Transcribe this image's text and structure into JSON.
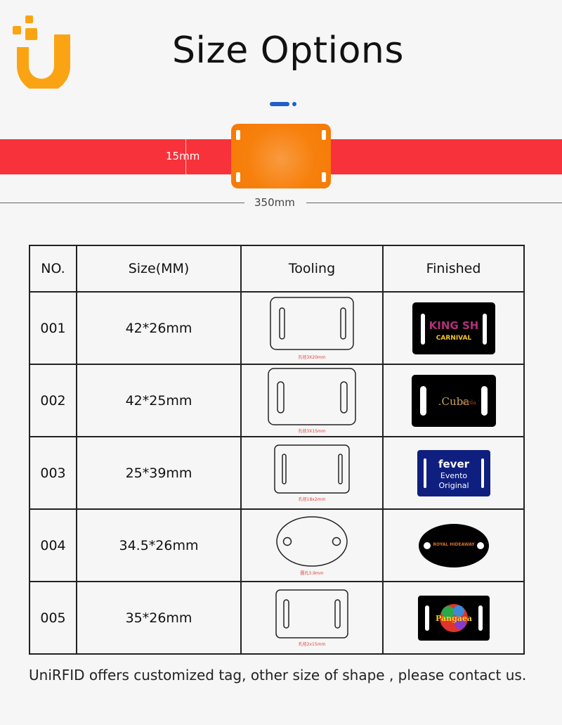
{
  "brand": {
    "logo_icon": "unirfid-u-logo-icon",
    "color_primary": "#fba413"
  },
  "header": {
    "title": "Size Options",
    "accent_color": "#1f5fc6"
  },
  "strap_diagram": {
    "width_label": "15mm",
    "length_label": "350mm",
    "strap_color": "#f7323a",
    "tag_color": "#f7800c"
  },
  "table": {
    "headers": [
      "NO.",
      "Size(MM)",
      "Tooling",
      "Finished"
    ],
    "rows": [
      {
        "no": "001",
        "size": "42*26mm",
        "tooling_shape": "rectangle",
        "tooling_caption": "孔径3X20mm",
        "finished_text": "KING SH CARNIVAL",
        "finished_color": "#000000"
      },
      {
        "no": "002",
        "size": "42*25mm",
        "tooling_shape": "rectangle",
        "tooling_caption": "孔径3X15mm",
        "finished_text": "Cuba",
        "finished_color": "#000000"
      },
      {
        "no": "003",
        "size": "25*39mm",
        "tooling_shape": "rectangle",
        "tooling_caption": "孔径18x2mm",
        "finished_text": "fever Evento Original",
        "finished_color": "#0f1f80"
      },
      {
        "no": "004",
        "size": "34.5*26mm",
        "tooling_shape": "oval",
        "tooling_caption": "圆孔3.9mm",
        "finished_text": "ROYAL HIDEAWAY",
        "finished_color": "#000000"
      },
      {
        "no": "005",
        "size": "35*26mm",
        "tooling_shape": "rectangle",
        "tooling_caption": "孔径2x15mm",
        "finished_text": "Pangaea",
        "finished_color": "#000000"
      }
    ]
  },
  "footer": {
    "text": "UniRFID offers customized tag, other size of shape , please contact us."
  }
}
